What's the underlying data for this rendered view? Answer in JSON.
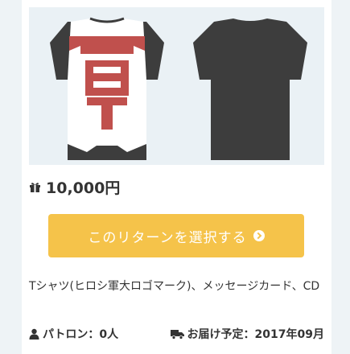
{
  "reward": {
    "price": "10,000円",
    "select_label": "このリターンを選択する",
    "description": "Tシャツ(ヒロシ軍大ロゴマーク)、メッセージカード、CD",
    "patrons_label": "パトロン：",
    "patrons_value": "0人",
    "delivery_label": "お届け予定：",
    "delivery_value": "2017年09月"
  },
  "image": {
    "front_logo_text": "軍"
  },
  "colors": {
    "background": "#eef3f6",
    "button": "#f5c34a",
    "shirt_dark": "#3d3d3d",
    "logo_red": "#c0504d"
  },
  "icons": {
    "price": "gift-icon",
    "select": "chevron-circle-right-icon",
    "patrons": "user-icon",
    "delivery": "truck-icon"
  }
}
